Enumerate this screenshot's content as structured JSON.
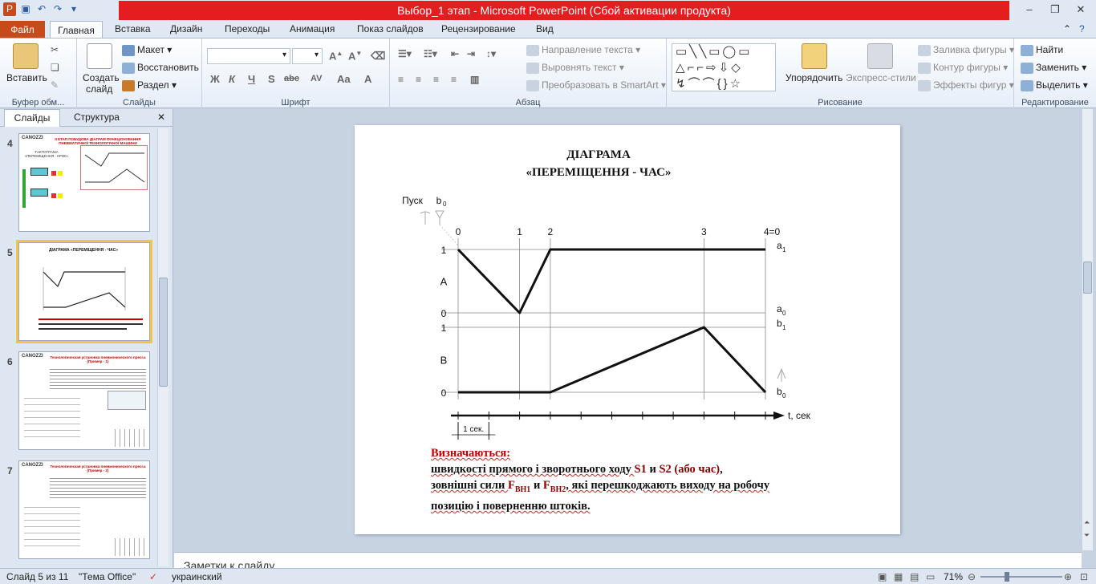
{
  "app": {
    "window_title": "Выбор_1 этап  -  Microsoft PowerPoint (Сбой активации продукта)"
  },
  "ribbon_tabs": [
    "Файл",
    "Главная",
    "Вставка",
    "Дизайн",
    "Переходы",
    "Анимация",
    "Показ слайдов",
    "Рецензирование",
    "Вид"
  ],
  "ribbon": {
    "clipboard": {
      "paste": "Вставить",
      "group": "Буфер обм..."
    },
    "slides": {
      "new_slide_1": "Создать",
      "new_slide_2": "слайд",
      "layout": "Макет",
      "reset": "Восстановить",
      "section": "Раздел",
      "group": "Слайды"
    },
    "font": {
      "group": "Шрифт",
      "bold": "Ж",
      "italic": "К",
      "underline": "Ч",
      "shadow": "S",
      "strike": "abc",
      "spacing": "AV",
      "case": "Aa",
      "color": "A"
    },
    "paragraph": {
      "text_dir": "Направление текста",
      "align_text": "Выровнять текст",
      "smartart": "Преобразовать в SmartArt",
      "group": "Абзац"
    },
    "drawing": {
      "arrange": "Упорядочить",
      "quick_styles": "Экспресс-стили",
      "fill": "Заливка фигуры",
      "outline": "Контур фигуры",
      "effects": "Эффекты фигур",
      "group": "Рисование"
    },
    "editing": {
      "find": "Найти",
      "replace": "Заменить",
      "select": "Выделить",
      "group": "Редактирование"
    }
  },
  "sidebar": {
    "tabs": [
      "Слайды",
      "Структура"
    ],
    "thumbs": [
      {
        "num": "4",
        "logo": "CANOZZI",
        "title": "II ЕТАП ПОБУДОВА ДІАГРАМ ФУНКЦІОНУВАННЯ ПНЕВМАТИЧНОЇ ТЕХНОЛОГІЧНОЇ МАШИНИ",
        "subtitle": "ТАКТОГРАМА «ПЕРЕМІЩЕННЯ - КРОК»"
      },
      {
        "num": "5",
        "title": "ДІАГРАМА «ПЕРЕМІЩЕННЯ - ЧАС»"
      },
      {
        "num": "6",
        "logo": "CANOZZI",
        "title": "Технологическая установка пневмонического пресса (Пример - 1)"
      },
      {
        "num": "7",
        "logo": "CANOZZI",
        "title": "Технологическая установка пневмонического пресса (Пример - 2)"
      }
    ]
  },
  "slide": {
    "title_line1": "ДІАГРАМА",
    "title_line2": "«ПЕРЕМІЩЕННЯ - ЧАС»",
    "heading": "Визначаються:",
    "line1a": "швидкості прямого і зворотнього ходу ",
    "s1": "S1",
    "and1": " и ",
    "s2": "S2 (або час)",
    "comma": ",",
    "line2a": "зовнішні сили  ",
    "f1": "F",
    "f1sub": "ВН1",
    "and2": " и ",
    "f2": "F",
    "f2sub": "ВН2",
    "line2b": ", які перешкоджають виходу на робочу",
    "line3": "позицію і поверненню штоків."
  },
  "chart_data": {
    "type": "line",
    "title": "",
    "xlabel": "t, сек",
    "ylabel": "",
    "start_label": "Пуск",
    "start_signal": "b0",
    "x_step_labels": [
      "0",
      "1",
      "2",
      "3",
      "4=0"
    ],
    "x_scale_label": "1 сек.",
    "series": [
      {
        "name": "A",
        "x": [
          0,
          2,
          3,
          8,
          10
        ],
        "y": [
          1,
          0,
          1,
          1,
          1
        ],
        "ymin_label": "0",
        "ymax_label": "1",
        "end_labels": [
          "a1",
          "a0"
        ]
      },
      {
        "name": "B",
        "x": [
          0,
          3,
          8,
          10
        ],
        "y": [
          0,
          0,
          1,
          0
        ],
        "ymin_label": "0",
        "ymax_label": "1",
        "end_labels": [
          "b1",
          "b0"
        ]
      }
    ]
  },
  "notes": {
    "placeholder": "Заметки к слайду"
  },
  "status": {
    "slide": "Слайд 5 из 11",
    "theme": "\"Тема Office\"",
    "lang": "украинский",
    "zoom": "71%"
  }
}
